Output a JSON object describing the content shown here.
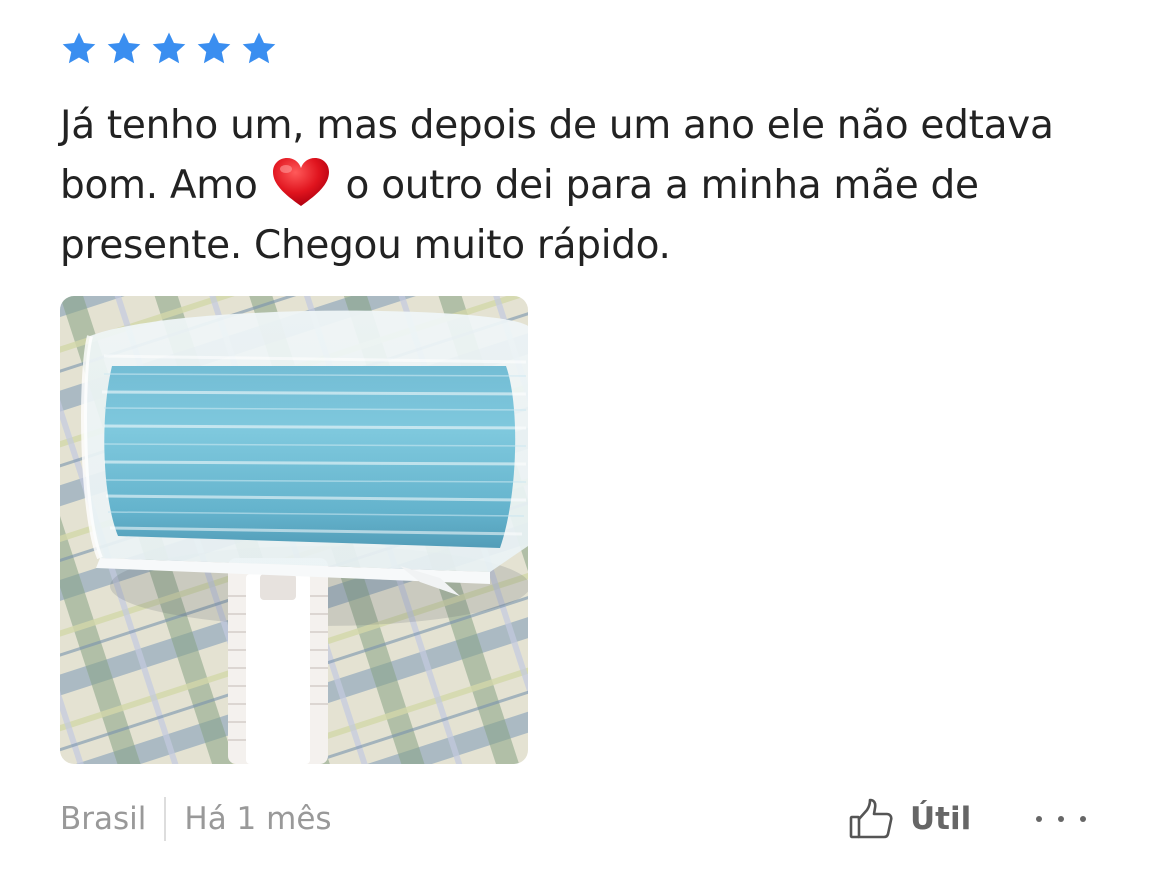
{
  "review": {
    "rating": 5,
    "rating_max": 5,
    "star_color": "#3a8ef0",
    "text_before_emoji": "Já tenho um, mas depois de um ano ele não edtava bom. Amo",
    "emoji": "heart-emoji",
    "text_after_emoji": "o outro dei para a minha mãe de presente. Chegou muito rápido.",
    "photo": "lint-roller-photo"
  },
  "footer": {
    "country": "Brasil",
    "time_ago": "Há 1 mês",
    "helpful_label": "Útil",
    "helpful_icon": "thumbs-up-icon",
    "more_icon": "more-options-icon"
  }
}
